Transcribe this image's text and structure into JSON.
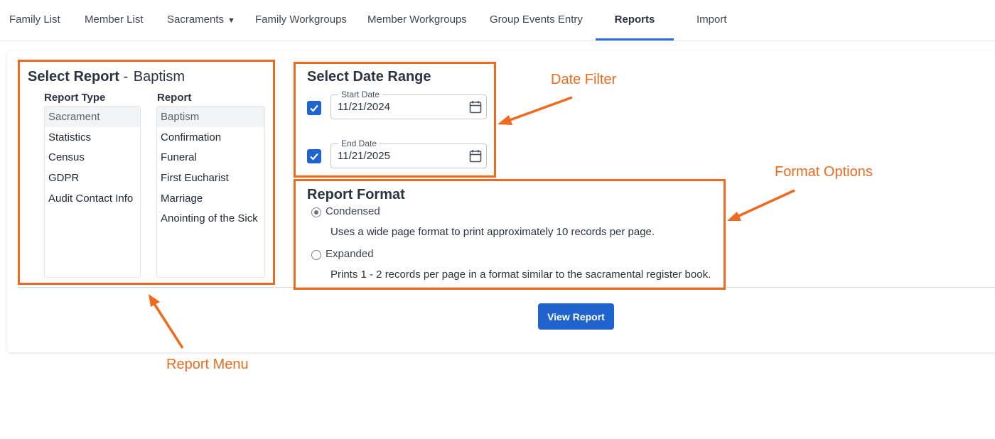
{
  "nav": {
    "tabs": [
      {
        "label": "Family List"
      },
      {
        "label": "Member List"
      },
      {
        "label": "Sacraments",
        "caret": "▼"
      },
      {
        "label": "Family Workgroups"
      },
      {
        "label": "Member Workgroups"
      },
      {
        "label": "Group Events Entry"
      },
      {
        "label": "Reports"
      },
      {
        "label": "Import"
      }
    ],
    "active_tab": "Reports"
  },
  "report_select": {
    "title": "Select Report",
    "separator": "-",
    "selected_report": "Baptism",
    "report_type_header": "Report Type",
    "report_header": "Report",
    "report_types": [
      "Sacrament",
      "Statistics",
      "Census",
      "GDPR",
      "Audit Contact Info"
    ],
    "reports": [
      "Baptism",
      "Confirmation",
      "Funeral",
      "First Eucharist",
      "Marriage",
      "Anointing of the Sick"
    ]
  },
  "date_range": {
    "title": "Select Date Range",
    "start": {
      "legend": "Start Date",
      "value": "11/21/2024",
      "checked": true
    },
    "end": {
      "legend": "End Date",
      "value": "11/21/2025",
      "checked": true
    }
  },
  "report_format": {
    "title": "Report Format",
    "options": [
      {
        "label": "Condensed",
        "description": "Uses a wide page format to print approximately 10 records per page.",
        "selected": true
      },
      {
        "label": "Expanded",
        "description": "Prints 1 - 2 records per page in a format similar to the sacramental register book.",
        "selected": false
      }
    ]
  },
  "actions": {
    "view_report_label": "View Report"
  },
  "annotations": {
    "date_filter": "Date Filter",
    "format_options": "Format Options",
    "report_menu": "Report Menu"
  },
  "colors": {
    "accent": "#1f63cf",
    "annotation": "#ef6a1f",
    "tab_underline": "#2f6fd0"
  }
}
